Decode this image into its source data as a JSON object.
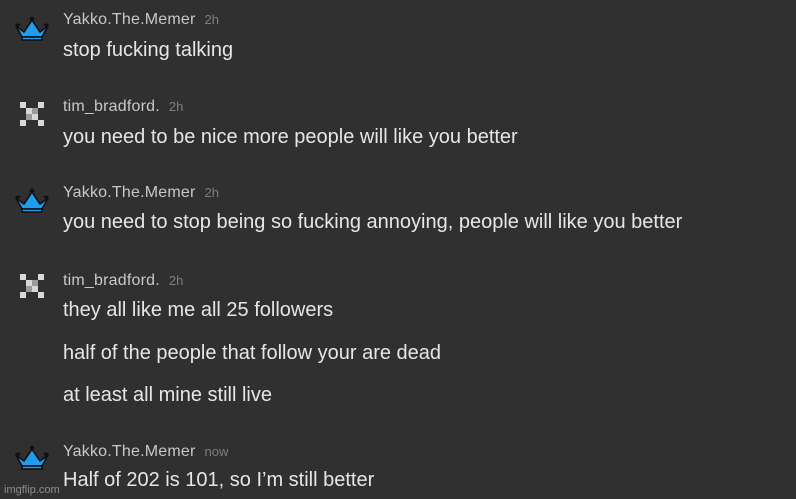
{
  "comments": [
    {
      "username": "Yakko.The.Memer",
      "time": "2h",
      "avatar": "blue-crown-icon",
      "lines": [
        "stop fucking talking"
      ]
    },
    {
      "username": "tim_bradford.",
      "time": "2h",
      "avatar": "checker-pixel-icon",
      "lines": [
        "you need to be nice more people will like you better"
      ]
    },
    {
      "username": "Yakko.The.Memer",
      "time": "2h",
      "avatar": "blue-crown-icon",
      "lines": [
        "you need to stop being so fucking annoying, people will like you better"
      ]
    },
    {
      "username": "tim_bradford.",
      "time": "2h",
      "avatar": "checker-pixel-icon",
      "lines": [
        "they all like me all 25 followers",
        "half of the people that follow your are dead",
        "at least all mine still live"
      ]
    },
    {
      "username": "Yakko.The.Memer",
      "time": "now",
      "avatar": "blue-crown-icon",
      "lines": [
        "Half of 202 is 101, so I’m still better"
      ]
    }
  ],
  "watermark": "imgflip.com",
  "colors": {
    "background": "#303030",
    "username": "#c8c8c8",
    "timestamp": "#7e7e7e",
    "message": "#e6e6e6",
    "crown_blue": "#1e9df0"
  }
}
